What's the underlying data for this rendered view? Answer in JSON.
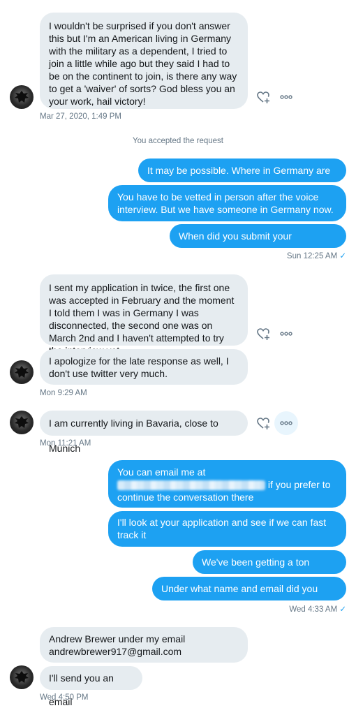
{
  "messages": {
    "m1": "I wouldn't be surprised if you don't answer this but I'm an American living in Germany with the military as a dependent, I tried to join a little while ago but they said I had to be on the continent to join, is there any way to get a 'waiver' of sorts? God bless you an your work, hail victory!",
    "t1": "Mar 27, 2020, 1:49 PM",
    "system": "You accepted the request",
    "o1": "It may be possible. Where in Germany are you?",
    "o2": "You have to be vetted in person after the voice interview. But we have someone in Germany now.",
    "o3": "When did you submit your application?",
    "t2": "Sun 12:25 AM",
    "m2": "I sent my application in twice, the first one was accepted in February and the moment I told them I was in Germany I was disconnected, the second one was on March 2nd and I haven't attempted to try the interview yet.",
    "m3": "I apologize for the late response as well, I don't use twitter very much.",
    "t3": "Mon 9:29 AM",
    "m4": "I am currently living in Bavaria, close to Munich",
    "t4": "Mon 11:21 AM",
    "o4a": "You can email me at",
    "o4b": "if you prefer to continue the conversation there",
    "o5": "I'll look at your application and see if we can fast track it",
    "o6": "We've been getting a ton recently",
    "o7": "Under what name and email did you apply?",
    "t5": "Wed 4:33 AM",
    "m5a": "Andrew Brewer under my email",
    "m5b": "andrewbrewer917@gmail.com",
    "m6": "I'll send you an email",
    "t6": "Wed 4:50 PM"
  },
  "read_check": "✓",
  "colors": {
    "outgoing": "#1da1f2",
    "incoming": "#e6ecf0",
    "meta": "#657786"
  },
  "icons": [
    "react-heart-icon",
    "more-options-icon",
    "avatar-image"
  ]
}
